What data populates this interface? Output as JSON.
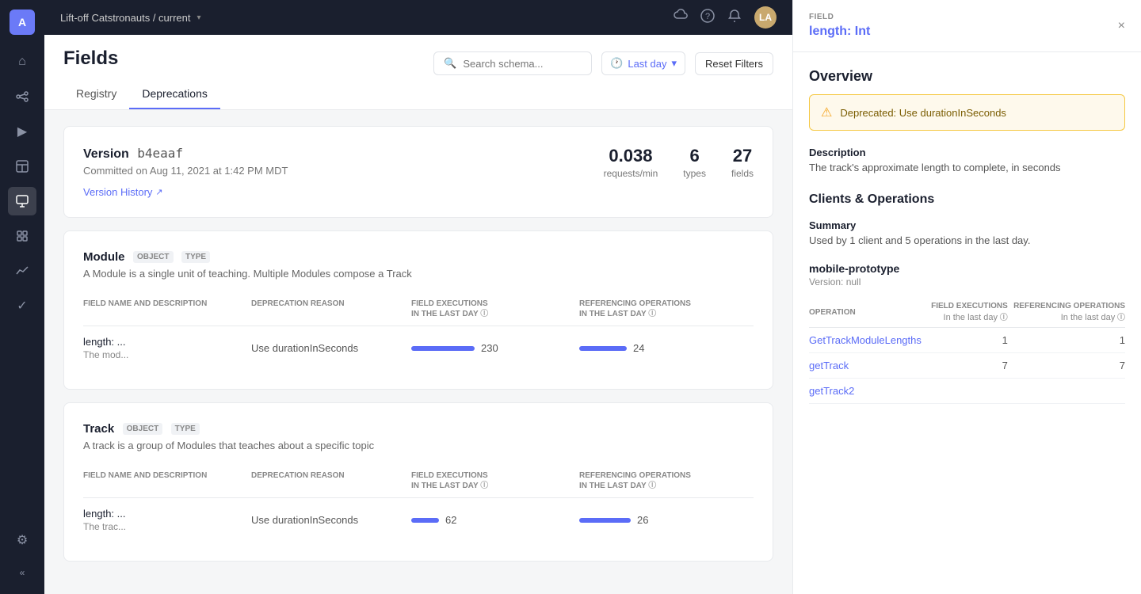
{
  "sidebar": {
    "logo": "A",
    "icons": [
      {
        "name": "home-icon",
        "symbol": "⌂",
        "active": false
      },
      {
        "name": "graph-icon",
        "symbol": "⋈",
        "active": false
      },
      {
        "name": "play-icon",
        "symbol": "▶",
        "active": false
      },
      {
        "name": "table-icon",
        "symbol": "▦",
        "active": false
      },
      {
        "name": "monitor-icon",
        "symbol": "▣",
        "active": true
      },
      {
        "name": "plugin-icon",
        "symbol": "⧉",
        "active": false
      },
      {
        "name": "chart-icon",
        "symbol": "∿",
        "active": false
      },
      {
        "name": "check-icon",
        "symbol": "✓",
        "active": false
      },
      {
        "name": "settings-icon",
        "symbol": "⚙",
        "active": false
      }
    ],
    "collapse_label": "«"
  },
  "topnav": {
    "brand": "Lift-off Catstronauts / current",
    "icons": [
      "monitor-icon",
      "help-icon",
      "bell-icon"
    ],
    "avatar_initials": "LA"
  },
  "page": {
    "title": "Fields",
    "tabs": [
      {
        "label": "Registry",
        "active": false
      },
      {
        "label": "Deprecations",
        "active": true
      }
    ],
    "search_placeholder": "Search schema...",
    "time_filter_label": "Last day",
    "reset_filters_label": "Reset Filters"
  },
  "version_card": {
    "label": "Version",
    "hash": "b4eaaf",
    "committed": "Committed on Aug 11, 2021 at 1:42 PM MDT",
    "version_history_link": "Version History",
    "stats": [
      {
        "value": "0.038",
        "label": "requests/min"
      },
      {
        "value": "6",
        "label": "types"
      },
      {
        "value": "27",
        "label": "fields"
      }
    ]
  },
  "module_card": {
    "name": "Module",
    "badges": [
      "OBJECT",
      "TYPE"
    ],
    "description": "A Module is a single unit of teaching. Multiple Modules compose a Track",
    "columns": {
      "field": "FIELD NAME AND DESCRIPTION",
      "reason": "DEPRECATION REASON",
      "executions": "FIELD EXECUTIONS IN THE LAST DAY",
      "operations": "REFERENCING OPERATIONS IN THE LAST DAY"
    },
    "rows": [
      {
        "field_name": "length: ...",
        "field_desc": "The mod...",
        "reason": "Use durationInSeconds",
        "executions_value": 230,
        "executions_bar_width": 80,
        "operations_value": 24,
        "operations_bar_width": 60
      }
    ]
  },
  "track_card": {
    "name": "Track",
    "badges": [
      "OBJECT",
      "TYPE"
    ],
    "description": "A track is a group of Modules that teaches about a specific topic",
    "columns": {
      "field": "FIELD NAME AND DESCRIPTION",
      "reason": "DEPRECATION REASON",
      "executions": "FIELD EXECUTIONS IN THE LAST DAY",
      "operations": "REFERENCING OPERATIONS IN THE LAST DAY"
    },
    "rows": [
      {
        "field_name": "length: ...",
        "field_desc": "The trac...",
        "reason": "Use durationInSeconds",
        "executions_value": 62,
        "executions_bar_width": 35,
        "operations_value": 26,
        "operations_bar_width": 65
      }
    ]
  },
  "right_panel": {
    "field_label": "FIELD",
    "field_title": "length:",
    "field_type": "Int",
    "close_label": "×",
    "overview_title": "Overview",
    "deprecation_warning": "Deprecated: Use durationInSeconds",
    "description_title": "Description",
    "description_text": "The track's approximate length to complete, in seconds",
    "clients_title": "Clients & Operations",
    "summary_title": "Summary",
    "summary_text": "Used by 1 client and 5 operations in the last day.",
    "client_name": "mobile-prototype",
    "client_version": "Version: null",
    "ops_columns": {
      "operation": "OPERATION",
      "executions": "FIELD EXECUTIONS",
      "executions_sub": "In the last day",
      "ref_ops": "REFERENCING OPERATIONS",
      "ref_ops_sub": "In the last day"
    },
    "operations": [
      {
        "name": "GetTrackModuleLengths",
        "executions": 1,
        "ref_ops": 1
      },
      {
        "name": "getTrack",
        "executions": 7,
        "ref_ops": 7
      },
      {
        "name": "getTrack2",
        "executions": null,
        "ref_ops": null
      }
    ]
  }
}
